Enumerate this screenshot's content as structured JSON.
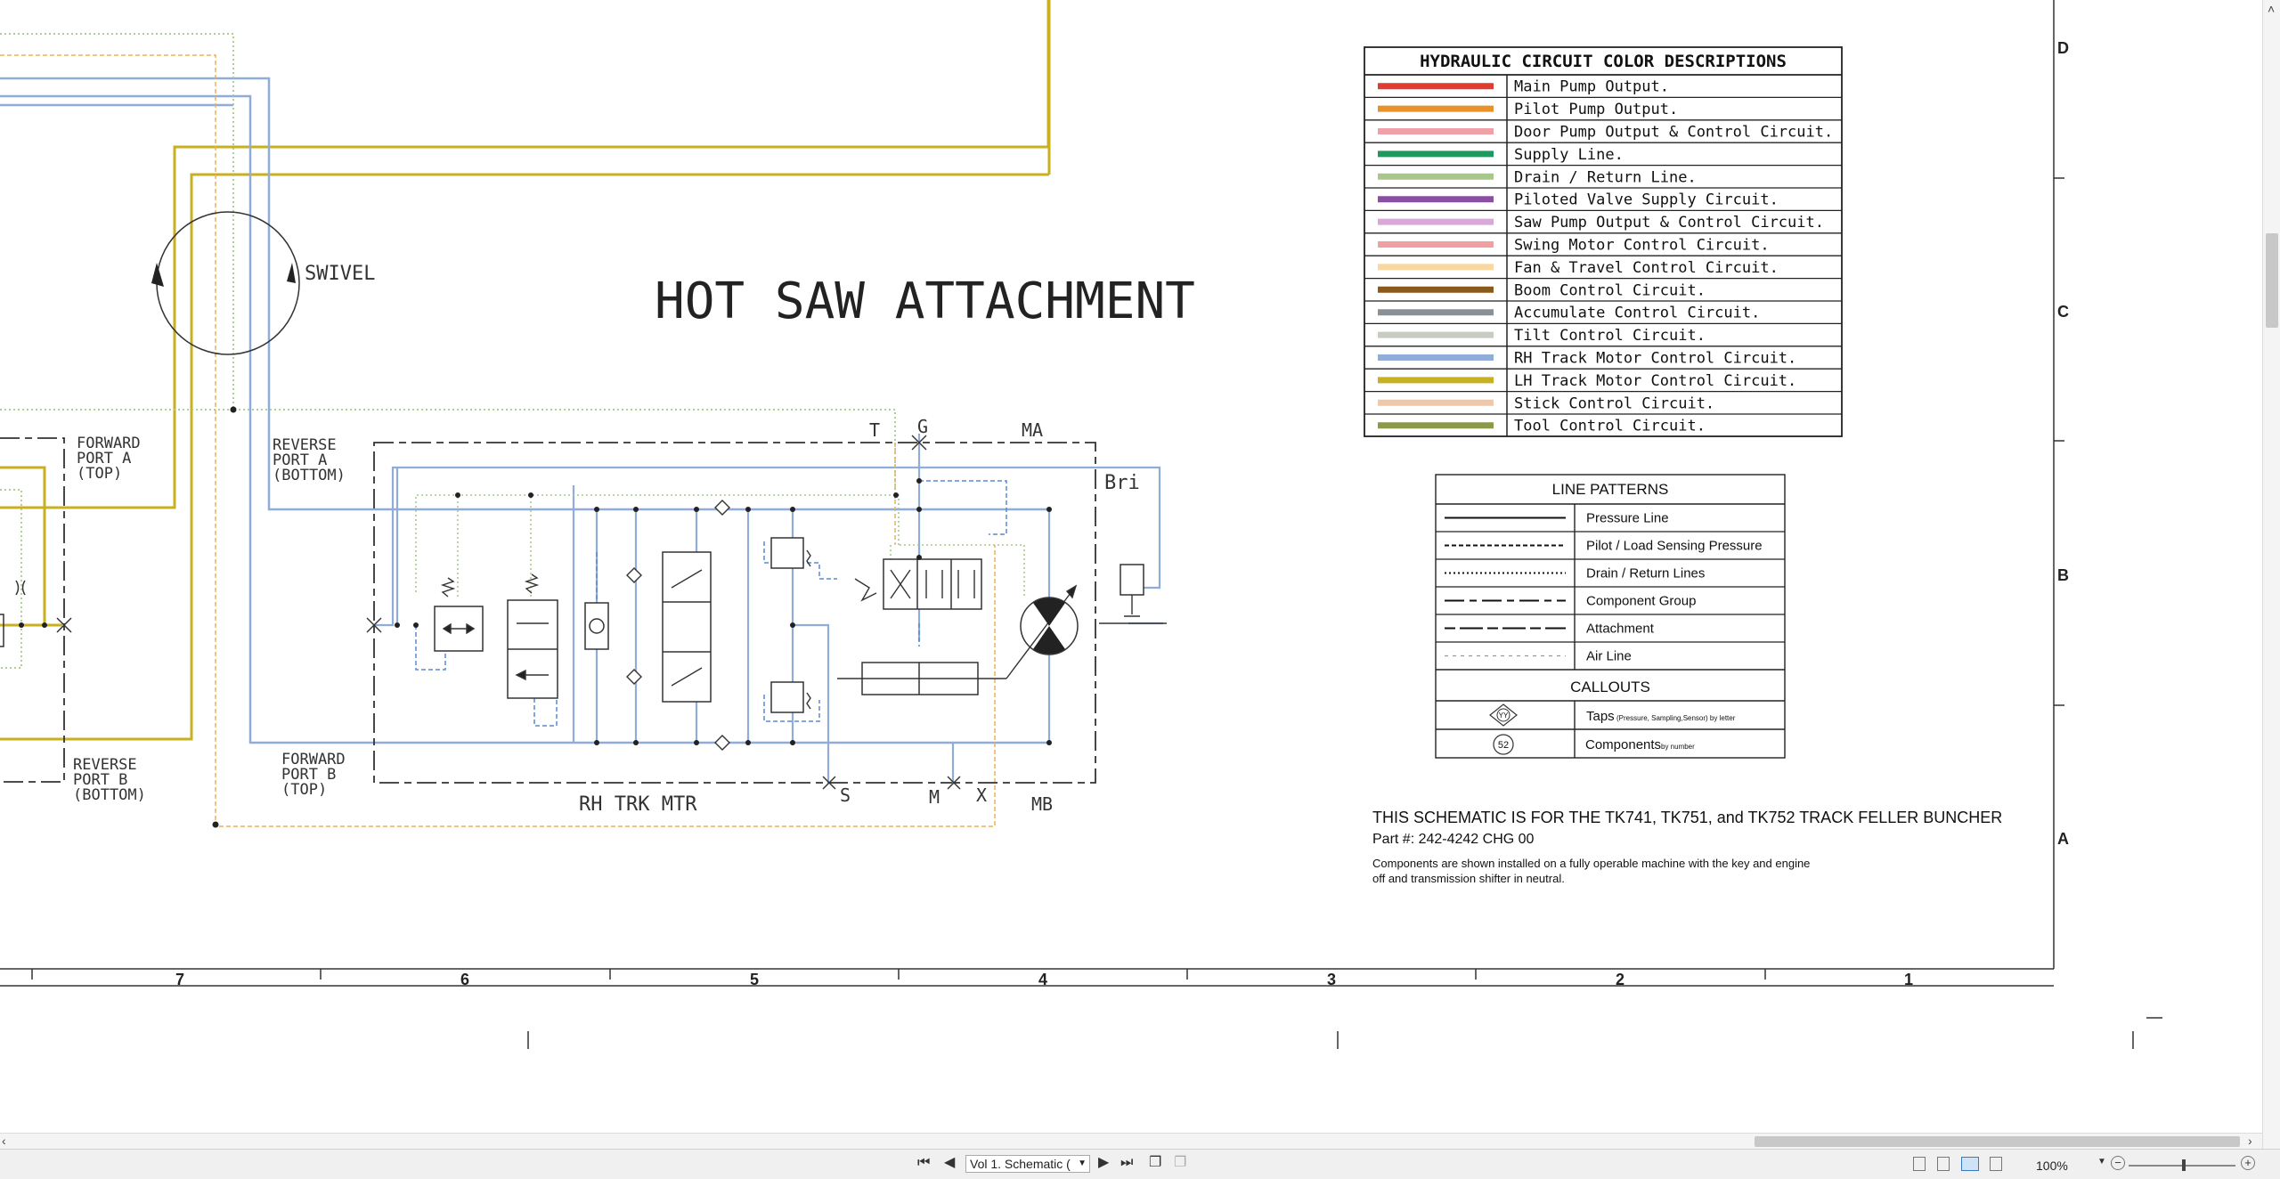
{
  "document": {
    "title": "HOT SAW ATTACHMENT",
    "swivel_label": "SWIVEL",
    "motor_label": "RH TRK MTR",
    "brake_label": "Bri",
    "port_labels": {
      "fwd_a": [
        "FORWARD",
        "PORT A",
        "(TOP)"
      ],
      "rev_a": [
        "REVERSE",
        "PORT A",
        "(BOTTOM)"
      ],
      "rev_b": [
        "REVERSE",
        "PORT B",
        "(BOTTOM)"
      ],
      "fwd_b": [
        "FORWARD",
        "PORT B",
        "(TOP)"
      ],
      "t": "T",
      "g": "G",
      "ma": "MA",
      "s": "S",
      "m": "M",
      "x": "X",
      "mb": "MB"
    }
  },
  "color_legend": {
    "header": "HYDRAULIC CIRCUIT COLOR DESCRIPTIONS",
    "items": [
      {
        "label": "Main Pump Output.",
        "color": "#e03c31"
      },
      {
        "label": "Pilot Pump Output.",
        "color": "#e8922a"
      },
      {
        "label": "Door Pump Output & Control Circuit.",
        "color": "#f0a0a8"
      },
      {
        "label": "Supply Line.",
        "color": "#1a9a5c"
      },
      {
        "label": "Drain / Return Line.",
        "color": "#a8c88a"
      },
      {
        "label": "Piloted Valve Supply Circuit.",
        "color": "#8a4fa0"
      },
      {
        "label": "Saw Pump Output & Control Circuit.",
        "color": "#d8a8d8"
      },
      {
        "label": "Swing Motor Control Circuit.",
        "color": "#f0a0a0"
      },
      {
        "label": "Fan & Travel Control Circuit.",
        "color": "#f8d8a0"
      },
      {
        "label": "Boom Control Circuit.",
        "color": "#8a5a1a"
      },
      {
        "label": "Accumulate Control Circuit.",
        "color": "#8a9098"
      },
      {
        "label": "Tilt Control Circuit.",
        "color": "#c8ccc0"
      },
      {
        "label": "RH Track Motor Control Circuit.",
        "color": "#90acd8"
      },
      {
        "label": "LH Track Motor Control Circuit.",
        "color": "#c8b020"
      },
      {
        "label": "Stick Control Circuit.",
        "color": "#f0c8a8"
      },
      {
        "label": "Tool Control Circuit.",
        "color": "#8a9a48"
      }
    ]
  },
  "line_patterns": {
    "header": "LINE PATTERNS",
    "items": [
      {
        "label": "Pressure Line",
        "dash": "none"
      },
      {
        "label": "Pilot / Load Sensing Pressure",
        "dash": "5,3"
      },
      {
        "label": "Drain / Return Lines",
        "dash": "2,3"
      },
      {
        "label": "Component Group",
        "dash": "22,6,8,6"
      },
      {
        "label": "Attachment",
        "dash": "12,5,26,5"
      },
      {
        "label": "Air Line",
        "dash": "4,5"
      }
    ],
    "callouts_header": "CALLOUTS",
    "taps_symbol": "YY",
    "taps_label": "Taps",
    "taps_note": "(Pressure, Sampling,Sensor) by letter",
    "components_symbol": "52",
    "components_label": "Components",
    "components_note": "by number"
  },
  "notes": {
    "line1": "THIS SCHEMATIC IS FOR THE TK741, TK751, and TK752 TRACK FELLER BUNCHER",
    "line2": "Part #: 242-4242 CHG 00",
    "line3": "Components are shown installed on a fully operable machine with the key and engine",
    "line4": "off and transmission shifter in neutral."
  },
  "ruler": {
    "columns": [
      "7",
      "6",
      "5",
      "4",
      "3",
      "2",
      "1"
    ],
    "rows": [
      "D",
      "C",
      "B",
      "A"
    ]
  },
  "viewer": {
    "page_select_value": "Vol 1. Schematic (",
    "zoom": "100%"
  }
}
